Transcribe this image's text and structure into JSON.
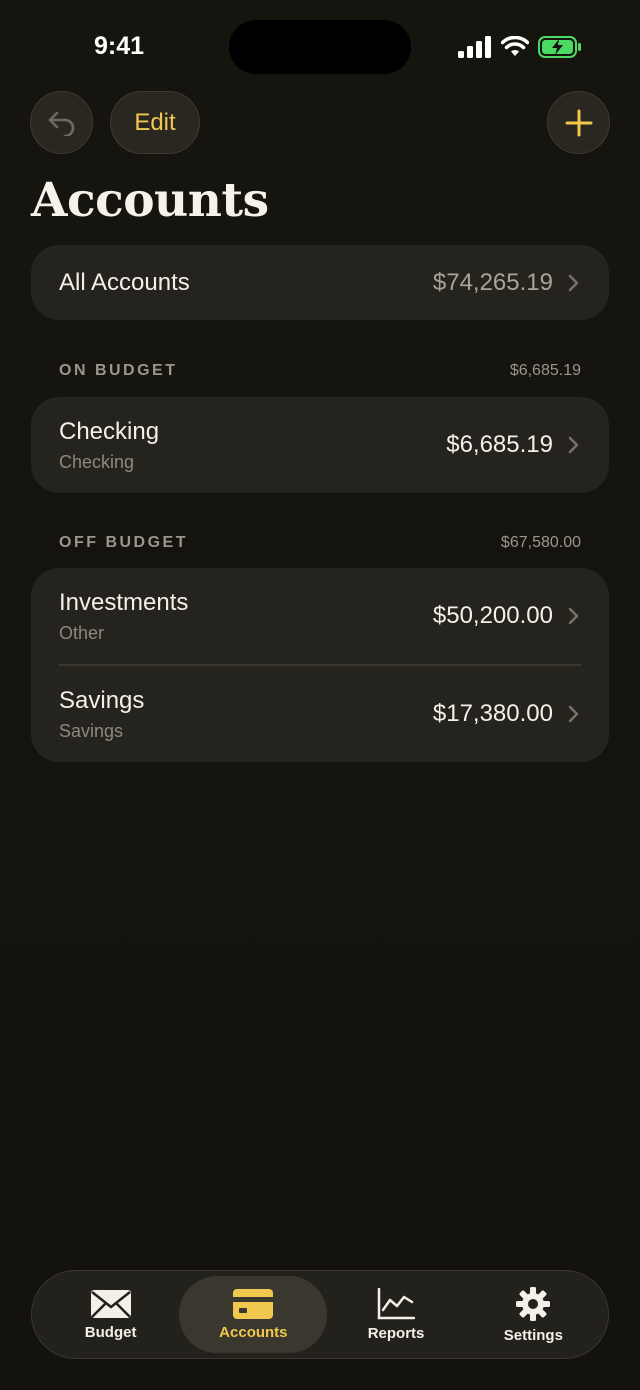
{
  "status_bar": {
    "time": "9:41"
  },
  "nav": {
    "edit_label": "Edit"
  },
  "page_title": "Accounts",
  "all_accounts": {
    "label": "All Accounts",
    "amount": "$74,265.19"
  },
  "on_budget": {
    "header": "ON BUDGET",
    "total": "$6,685.19",
    "accounts": [
      {
        "name": "Checking",
        "type": "Checking",
        "amount": "$6,685.19"
      }
    ]
  },
  "off_budget": {
    "header": "OFF BUDGET",
    "total": "$67,580.00",
    "accounts": [
      {
        "name": "Investments",
        "type": "Other",
        "amount": "$50,200.00"
      },
      {
        "name": "Savings",
        "type": "Savings",
        "amount": "$17,380.00"
      }
    ]
  },
  "tabs": [
    {
      "label": "Budget",
      "icon": "envelope-icon",
      "active": false
    },
    {
      "label": "Accounts",
      "icon": "credit-card-icon",
      "active": true
    },
    {
      "label": "Reports",
      "icon": "chart-icon",
      "active": false
    },
    {
      "label": "Settings",
      "icon": "gear-icon",
      "active": false
    }
  ],
  "colors": {
    "accent": "#f1c84e",
    "background": "#15130f",
    "card": "#25231d",
    "battery": "#4cd964"
  }
}
